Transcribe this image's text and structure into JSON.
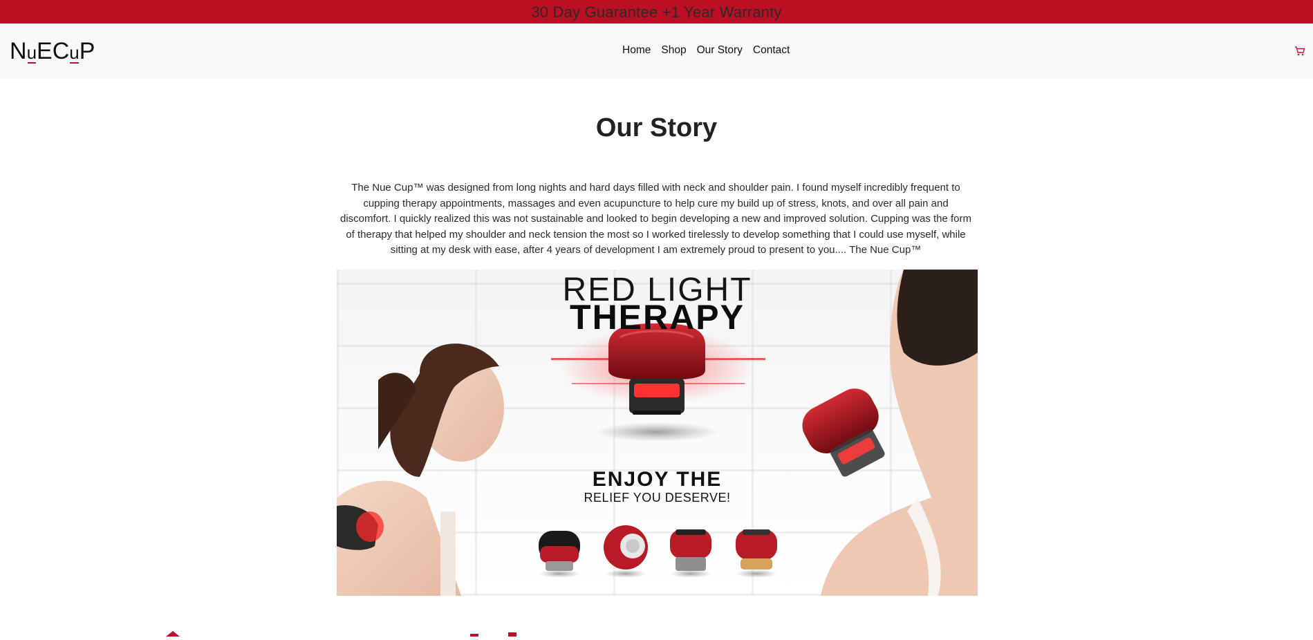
{
  "announcement": {
    "text": "30 Day Guarantee +1 Year Warranty"
  },
  "brand": {
    "logo_parts": [
      "N",
      "u",
      "EC",
      "u",
      "P"
    ]
  },
  "nav": {
    "items": [
      {
        "label": "Home"
      },
      {
        "label": "Shop"
      },
      {
        "label": "Our Story"
      },
      {
        "label": "Contact"
      }
    ],
    "cart_icon": "cart-icon"
  },
  "page": {
    "title": "Our Story",
    "body": "The Nue Cup™ was designed from long nights and hard days filled with neck and shoulder pain. I found myself incredibly frequent to cupping therapy appointments, massages and even acupuncture to help cure my build up of stress, knots, and over all pain and discomfort. I quickly realized this was not sustainable and looked to begin developing a new and improved solution. Cupping was the form of therapy that helped my shoulder and neck tension the most so I worked tirelessly to develop something that I could use myself, while sitting at my desk with ease, after 4 years of development I am extremely proud to present to you.... The Nue Cup™"
  },
  "hero_image": {
    "headline_line1": "RED LIGHT",
    "headline_line2": "THERAPY",
    "tagline_line1": "ENJOY THE",
    "tagline_line2": "RELIEF YOU DESERVE!"
  },
  "colors": {
    "brand_red": "#bb1023",
    "nav_bg": "#f7f8f9",
    "text_dark": "#222222"
  }
}
